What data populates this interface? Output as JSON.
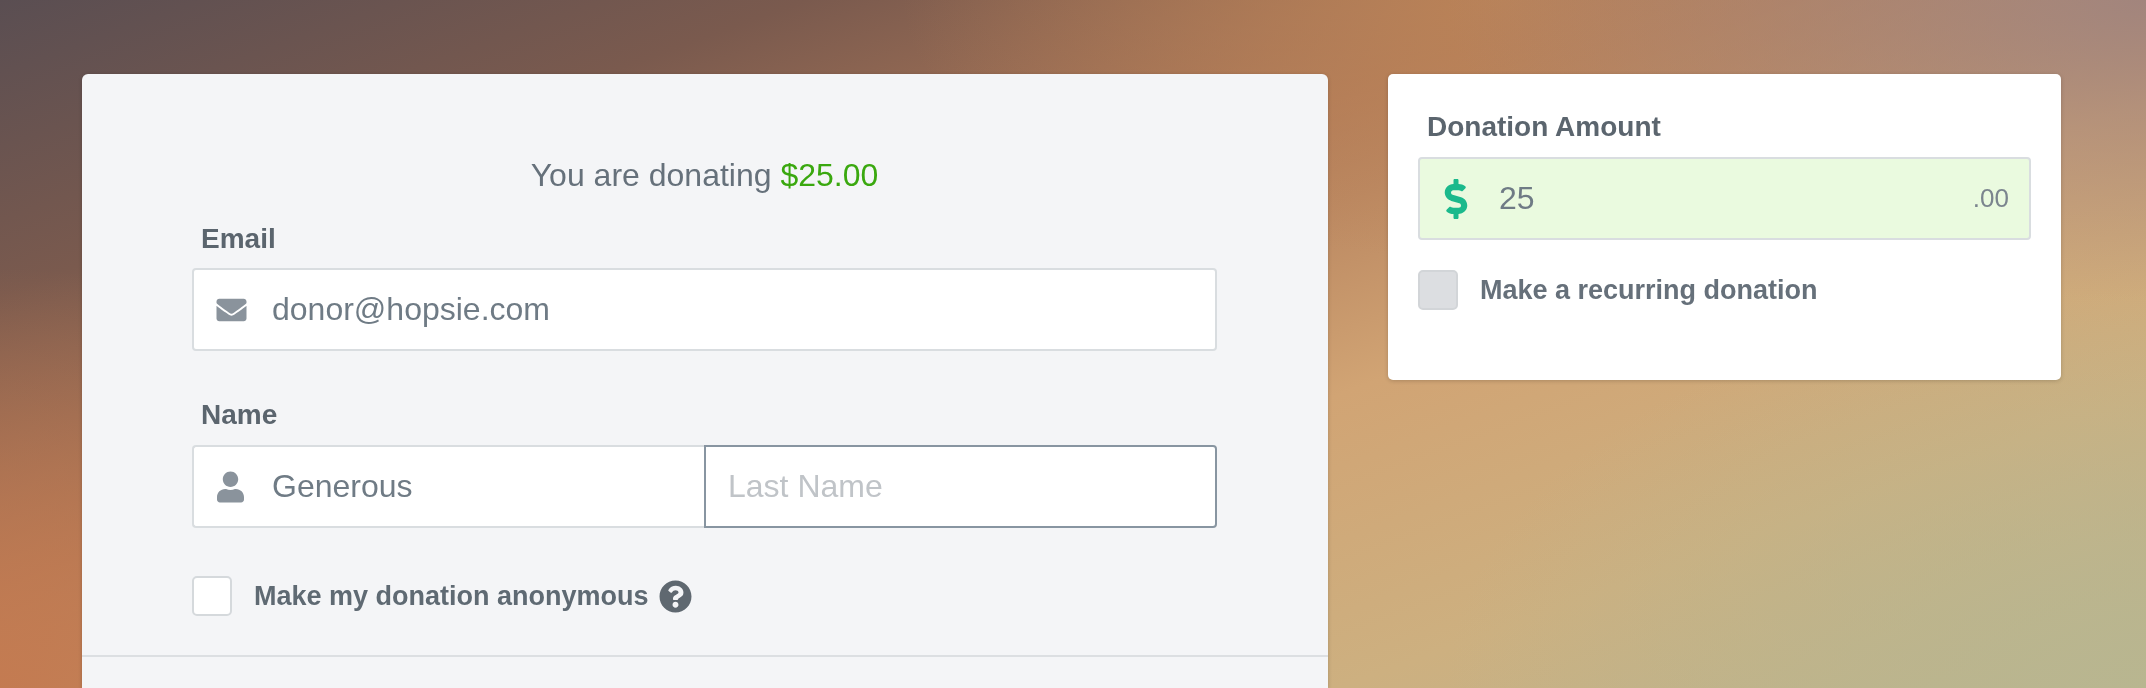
{
  "donation_summary": {
    "text": "You are donating",
    "amount": "$25.00"
  },
  "form": {
    "email": {
      "label": "Email",
      "value": "donor@hopsie.com",
      "focused": false
    },
    "name": {
      "label": "Name",
      "first_name": {
        "value": "Generous",
        "focused": false
      },
      "last_name": {
        "placeholder": "Last Name",
        "focused": true
      }
    },
    "anonymous": {
      "label": "Make my donation anonymous",
      "checked": false,
      "disabled": false
    }
  },
  "amount_panel": {
    "label": "Donation Amount",
    "value": "25",
    "cents": ".00",
    "valid": true,
    "recurring": {
      "label": "Make a recurring donation",
      "checked": false,
      "disabled": true
    }
  }
}
